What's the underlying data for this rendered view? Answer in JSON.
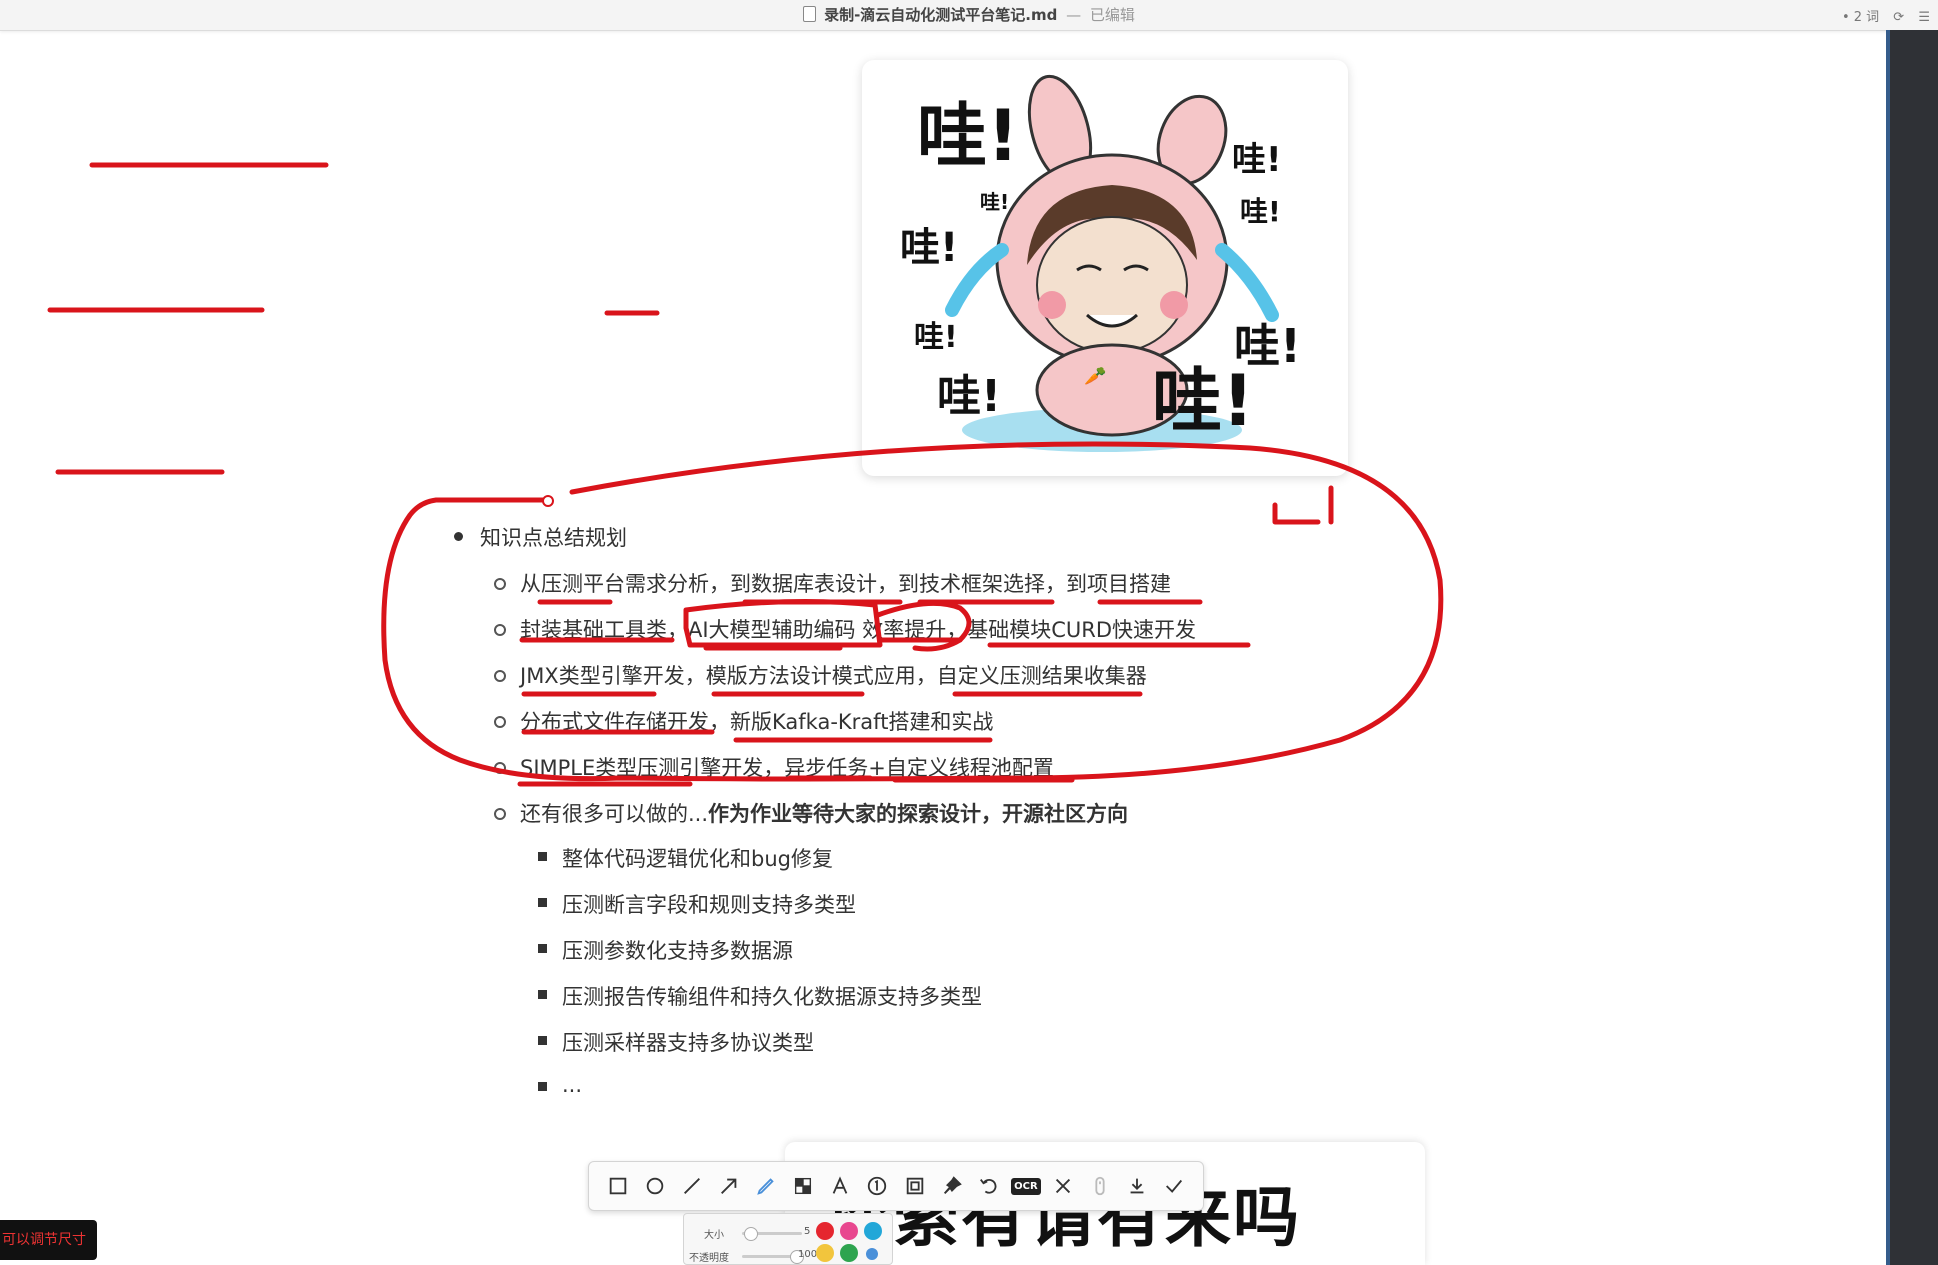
{
  "window": {
    "title": "录制-滴云自动化测试平台笔记.md",
    "separator": "—",
    "state": "已编辑",
    "word_count": "• 2 词"
  },
  "sticker": {
    "texts": [
      "哇!",
      "哇!",
      "哇!",
      "哇!",
      "哇!",
      "哇!",
      "哇!",
      "哇!",
      "哇!"
    ]
  },
  "outline": {
    "heading": "知识点总结规划",
    "items": [
      "从压测平台需求分析，到数据库表设计，到技术框架选择，到项目搭建",
      "封装基础工具类，AI大模型辅助编码 效率提升，基础模块CURD快速开发",
      "JMX类型引擎开发，模版方法设计模式应用，自定义压测结果收集器",
      "分布式文件存储开发，新版Kafka-Kraft搭建和实战",
      "SIMPLE类型压测引擎开发，异步任务+自定义线程池配置"
    ],
    "more": {
      "prefix": "还有很多可以做的...",
      "bold": "作为作业等待大家的探索设计，开源社区方向"
    },
    "subitems": [
      "整体代码逻辑优化和bug修复",
      "压测断言字段和规则支持多类型",
      "压测参数化支持多数据源",
      "压测报告传输组件和持久化数据源支持多类型",
      "压测采样器支持多协议类型",
      "..."
    ]
  },
  "bottom_card": {
    "text": "探索有请有来吗"
  },
  "toolbar": {
    "tools": [
      "rectangle-tool",
      "ellipse-tool",
      "line-tool",
      "arrow-tool",
      "pen-tool",
      "mosaic-tool",
      "text-tool",
      "number-tool",
      "blur-tool",
      "pin-tool",
      "undo-tool",
      "ocr-tool",
      "close-tool",
      "scroll-tool",
      "download-tool",
      "confirm-tool"
    ],
    "ocr_label": "OCR"
  },
  "brush_panel": {
    "size_label": "大小",
    "size_value": "5",
    "opacity_label": "不透明度",
    "opacity_value": "100",
    "size_level": 0.05,
    "opacity_level": 1.0,
    "colors": [
      "#e5262f",
      "#e8478f",
      "#22a7d8",
      "#f2c53d",
      "#2ea44f",
      "#4a90d9"
    ]
  },
  "resize_tip": "可以调节尺寸",
  "colors": {
    "annotation_red": "#d9141b",
    "accent": "#4a90d9"
  }
}
